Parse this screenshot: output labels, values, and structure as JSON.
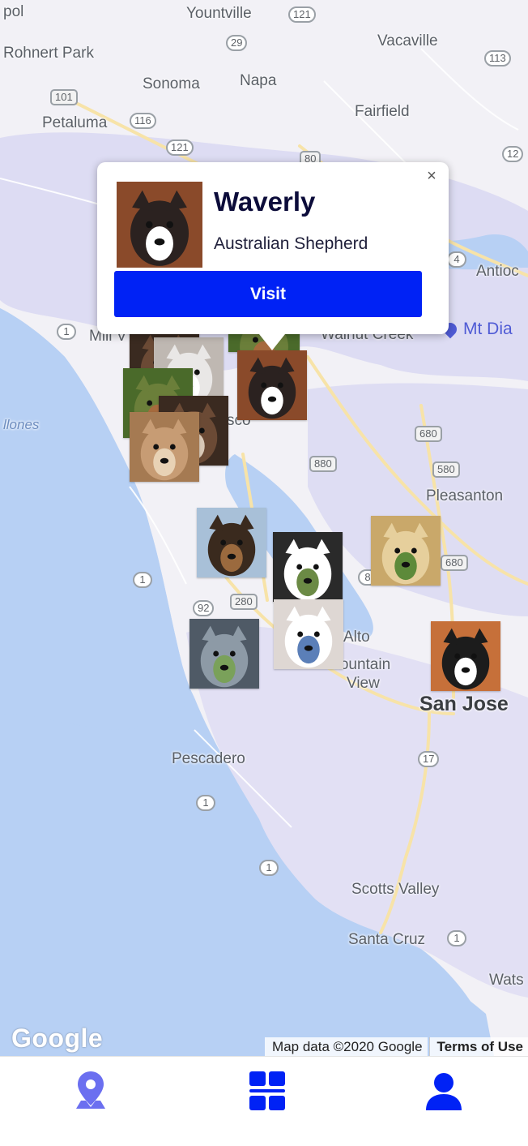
{
  "map": {
    "places": [
      {
        "label": "Yountville"
      },
      {
        "label": "Rohnert Park"
      },
      {
        "label": "Vacaville"
      },
      {
        "label": "Sonoma"
      },
      {
        "label": "Napa"
      },
      {
        "label": "Fairfield"
      },
      {
        "label": "Petaluma"
      },
      {
        "label": "Antioc"
      },
      {
        "label": "Mill V"
      },
      {
        "label": "Walnut Creek"
      },
      {
        "label": "Pleasanton"
      },
      {
        "label": "San Jose"
      },
      {
        "label": "Alto"
      },
      {
        "label": "Mountain"
      },
      {
        "label": "View"
      },
      {
        "label": "Pescadero"
      },
      {
        "label": "Scotts Valley"
      },
      {
        "label": "Santa Cruz"
      },
      {
        "label": "Wats"
      },
      {
        "label": "pol"
      },
      {
        "label": "sco"
      },
      {
        "label": "llones"
      }
    ],
    "shields": [
      "121",
      "29",
      "113",
      "101",
      "116",
      "121",
      "80",
      "12",
      "1",
      "4",
      "680",
      "880",
      "580",
      "680",
      "1",
      "280",
      "92",
      "8",
      "17",
      "1",
      "1",
      "1"
    ],
    "poi": {
      "label": "Mt Dia",
      "color": "#4f5bd5"
    },
    "attribution": {
      "map_data": "Map data ©2020 Google",
      "terms": "Terms of Use"
    },
    "logo": "Google"
  },
  "info_window": {
    "name": "Waverly",
    "breed": "Australian Shepherd",
    "visit_label": "Visit",
    "close_icon": "×"
  },
  "dog_markers": [
    {
      "id": "waverly",
      "colors": [
        "#2b2220",
        "#ffffff",
        "#8a4a2a"
      ]
    },
    {
      "id": "dog-2",
      "colors": [
        "#6b4a35",
        "#d9c8b6",
        "#3a2a20"
      ]
    },
    {
      "id": "dog-3",
      "colors": [
        "#e9e7e6",
        "#ffffff",
        "#bfb8b2"
      ]
    },
    {
      "id": "dog-4",
      "colors": [
        "#6b7f3a",
        "#a66a3d",
        "#4a6a2a"
      ]
    },
    {
      "id": "chihuahua",
      "colors": [
        "#c79c74",
        "#e8d2b5",
        "#a57a52"
      ]
    },
    {
      "id": "hound",
      "colors": [
        "#3a2a1e",
        "#9b6a3e",
        "#a8c0d8"
      ]
    },
    {
      "id": "frenchie",
      "colors": [
        "#ffffff",
        "#6b8a45",
        "#2a2a2a"
      ]
    },
    {
      "id": "golden",
      "colors": [
        "#e6cf9c",
        "#5d8a3a",
        "#c9a86a"
      ]
    },
    {
      "id": "bull-terrier",
      "colors": [
        "#ffffff",
        "#5b7fb8",
        "#ded7d3"
      ]
    },
    {
      "id": "greyhound",
      "colors": [
        "#8d9aa6",
        "#7aa15a",
        "#4f5a66"
      ]
    },
    {
      "id": "border-collie",
      "colors": [
        "#1c1c1c",
        "#ffffff",
        "#c6703a"
      ]
    }
  ],
  "bottom_nav": {
    "items": [
      {
        "name": "map-pin-icon",
        "color": "#6b6ff0"
      },
      {
        "name": "grid-icon",
        "color": "#0022f5"
      },
      {
        "name": "user-icon",
        "color": "#0022f5"
      }
    ]
  }
}
